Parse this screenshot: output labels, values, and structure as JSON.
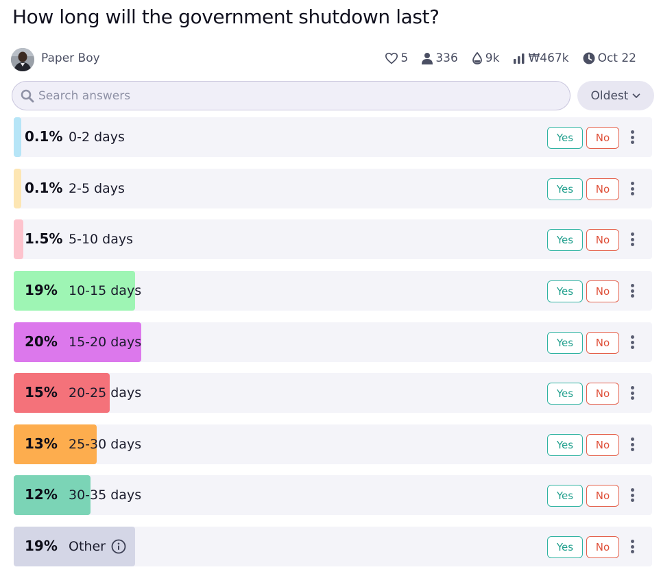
{
  "question": {
    "title": "How long will the government shutdown last?"
  },
  "author": {
    "name": "Paper Boy"
  },
  "stats": {
    "likes": "5",
    "traders": "336",
    "liquidity": "9k",
    "volume": "₩467k",
    "date": "Oct 22"
  },
  "search": {
    "placeholder": "Search answers"
  },
  "sort": {
    "label": "Oldest"
  },
  "buttons": {
    "yes": "Yes",
    "no": "No"
  },
  "answers": [
    {
      "pct": "0.1%",
      "label": "0-2 days",
      "color": "#b6e5f7",
      "fill": 0.012
    },
    {
      "pct": "0.1%",
      "label": "2-5 days",
      "color": "#fde6b3",
      "fill": 0.012
    },
    {
      "pct": "1.5%",
      "label": "5-10 days",
      "color": "#fdc3cd",
      "fill": 0.015
    },
    {
      "pct": "19%",
      "label": "10-15 days",
      "color": "#9ef5b4",
      "fill": 0.19
    },
    {
      "pct": "20%",
      "label": "15-20 days",
      "color": "#dc78ec",
      "fill": 0.2
    },
    {
      "pct": "15%",
      "label": "20-25 days",
      "color": "#f4727a",
      "fill": 0.15
    },
    {
      "pct": "13%",
      "label": "25-30 days",
      "color": "#fdad4e",
      "fill": 0.13
    },
    {
      "pct": "12%",
      "label": "30-35 days",
      "color": "#7bd4b6",
      "fill": 0.12
    },
    {
      "pct": "19%",
      "label": "Other",
      "color": "#d4d6e6",
      "fill": 0.19
    }
  ]
}
